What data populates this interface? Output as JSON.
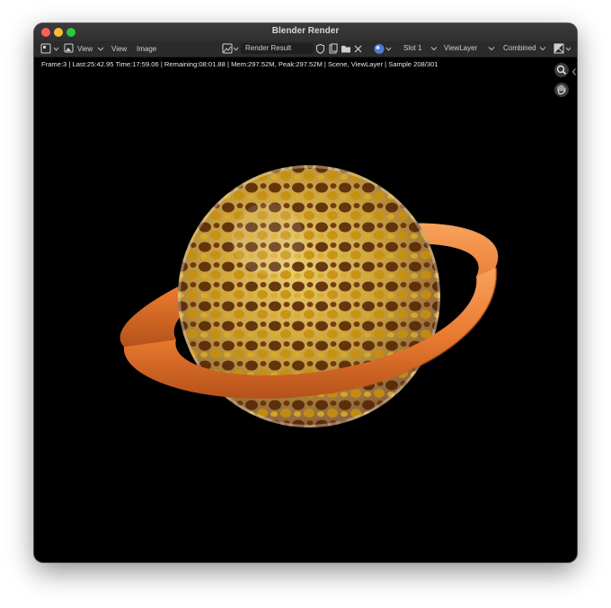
{
  "window": {
    "title": "Blender Render"
  },
  "header": {
    "editor_type_icon": "image-editor-icon",
    "view_menu_icon": "view-icon",
    "view_dropdown_label": "View",
    "menu_view": "View",
    "menu_image": "Image",
    "image_browse_icon": "image-browse-icon",
    "image_name": "Render Result",
    "fake_user_icon": "shield-icon",
    "new_image_icon": "new-image-icon",
    "open_image_icon": "folder-icon",
    "unlink_icon": "close-icon",
    "display_channels_icon": "sphere-icon",
    "slot_label": "Slot 1",
    "view_layer_label": "ViewLayer",
    "pass_label": "Combined",
    "overlay_icon": "display-mode-icon"
  },
  "status_text": "Frame:3 | Last:25:42.95 Time:17:59.06 | Remaining:08:01.88 | Mem:297.52M, Peak:297.52M | Scene, ViewLayer | Sample 208/301",
  "viewport_nav": {
    "zoom_icon": "zoom-icon",
    "pan_icon": "hand-icon",
    "collapse_icon": "chevron-left-icon"
  },
  "colors": {
    "ring": "#f08a3c",
    "sphere_gold": "#d4a018",
    "sphere_brown": "#5a2a0a",
    "sphere_white": "#f2efe6",
    "background": "#000000"
  }
}
